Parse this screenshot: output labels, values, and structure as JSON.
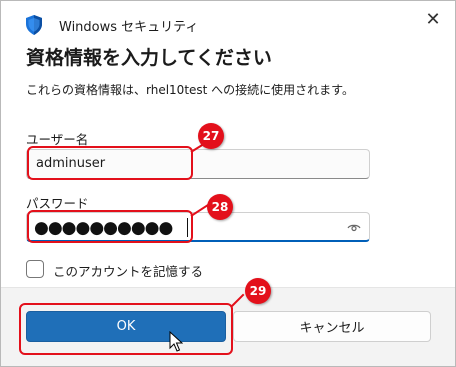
{
  "window": {
    "title": "Windows セキュリティ",
    "close_glyph": "✕"
  },
  "heading": "資格情報を入力してください",
  "description": "これらの資格情報は、rhel10test への接続に使用されます。",
  "username": {
    "label": "ユーザー名",
    "value": "adminuser"
  },
  "password": {
    "label": "パスワード",
    "masked_value": "●●●●●●●●●●"
  },
  "remember": {
    "label": "このアカウントを記憶する",
    "checked": false
  },
  "buttons": {
    "ok_label": "OK",
    "cancel_label": "キャンセル"
  },
  "annotations": {
    "username_step": "27",
    "password_step": "28",
    "ok_step": "29"
  },
  "colors": {
    "accent": "#1f6fb8",
    "annotation": "#e3101b"
  },
  "icons": [
    "shield-icon",
    "close-icon",
    "eye-icon",
    "mouse-cursor-icon"
  ]
}
